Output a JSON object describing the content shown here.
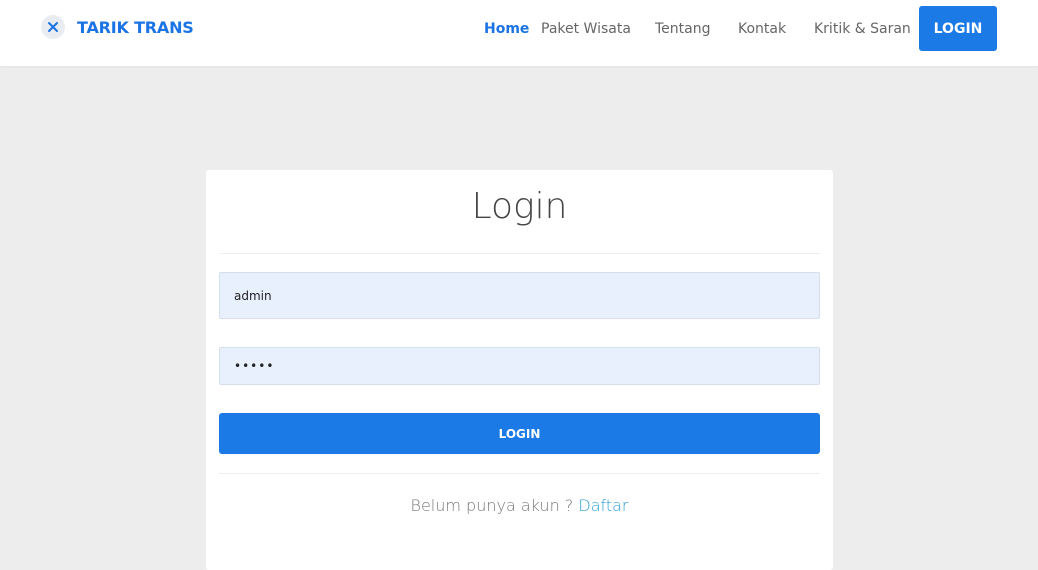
{
  "brand": {
    "name": "TARIK TRANS",
    "icon": "plane-icon",
    "color": "#1b74e4"
  },
  "nav": {
    "links": [
      {
        "label": "Home",
        "active": true
      },
      {
        "label": "Paket Wisata",
        "active": false
      },
      {
        "label": "Tentang",
        "active": false
      },
      {
        "label": "Kontak",
        "active": false
      },
      {
        "label": "Kritik & Saran",
        "active": false
      }
    ],
    "login_button": "LOGIN"
  },
  "login_form": {
    "title": "Login",
    "username_value": "admin",
    "password_value": "•••••",
    "submit_label": "LOGIN",
    "register_prompt": "Belum punya akun ?",
    "register_link": "Daftar"
  },
  "colors": {
    "accent": "#1b7ae6",
    "page_background": "#ededed",
    "input_background": "#e8f0fe",
    "link": "#2a9fd6"
  }
}
